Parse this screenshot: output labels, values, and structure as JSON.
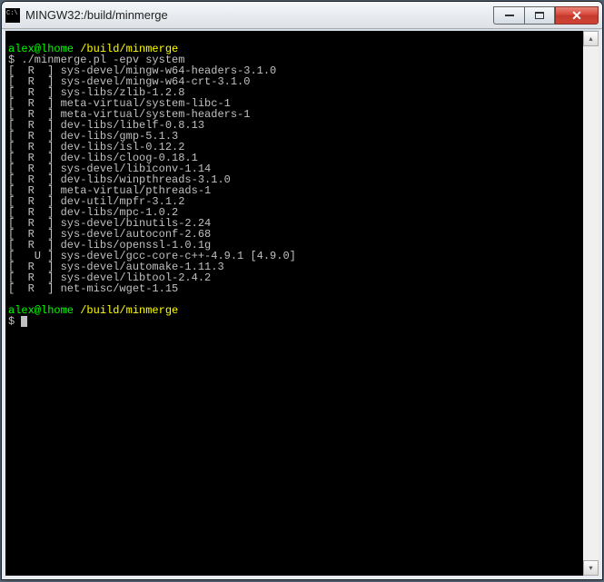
{
  "window": {
    "title": "MINGW32:/build/minmerge"
  },
  "prompt": {
    "user_host": "alex@lhome",
    "path": "/build/minmerge"
  },
  "command": "$ ./minmerge.pl -epv system",
  "packages": [
    {
      "flag": "R",
      "name": "sys-devel/mingw-w64-headers-3.1.0",
      "ver": ""
    },
    {
      "flag": "R",
      "name": "sys-devel/mingw-w64-crt-3.1.0",
      "ver": ""
    },
    {
      "flag": "R",
      "name": "sys-libs/zlib-1.2.8",
      "ver": ""
    },
    {
      "flag": "R",
      "name": "meta-virtual/system-libc-1",
      "ver": ""
    },
    {
      "flag": "R",
      "name": "meta-virtual/system-headers-1",
      "ver": ""
    },
    {
      "flag": "R",
      "name": "dev-libs/libelf-0.8.13",
      "ver": ""
    },
    {
      "flag": "R",
      "name": "dev-libs/gmp-5.1.3",
      "ver": ""
    },
    {
      "flag": "R",
      "name": "dev-libs/isl-0.12.2",
      "ver": ""
    },
    {
      "flag": "R",
      "name": "dev-libs/cloog-0.18.1",
      "ver": ""
    },
    {
      "flag": "R",
      "name": "sys-devel/libiconv-1.14",
      "ver": ""
    },
    {
      "flag": "R",
      "name": "dev-libs/winpthreads-3.1.0",
      "ver": ""
    },
    {
      "flag": "R",
      "name": "meta-virtual/pthreads-1",
      "ver": ""
    },
    {
      "flag": "R",
      "name": "dev-util/mpfr-3.1.2",
      "ver": ""
    },
    {
      "flag": "R",
      "name": "dev-libs/mpc-1.0.2",
      "ver": ""
    },
    {
      "flag": "R",
      "name": "sys-devel/binutils-2.24",
      "ver": ""
    },
    {
      "flag": "R",
      "name": "sys-devel/autoconf-2.68",
      "ver": ""
    },
    {
      "flag": "R",
      "name": "dev-libs/openssl-1.0.1g",
      "ver": ""
    },
    {
      "flag": "U",
      "name": "sys-devel/gcc-core-c++-4.9.1",
      "ver": "[4.9.0]"
    },
    {
      "flag": "R",
      "name": "sys-devel/automake-1.11.3",
      "ver": ""
    },
    {
      "flag": "R",
      "name": "sys-devel/libtool-2.4.2",
      "ver": ""
    },
    {
      "flag": "R",
      "name": "net-misc/wget-1.15",
      "ver": ""
    }
  ],
  "final_prompt": "$ "
}
